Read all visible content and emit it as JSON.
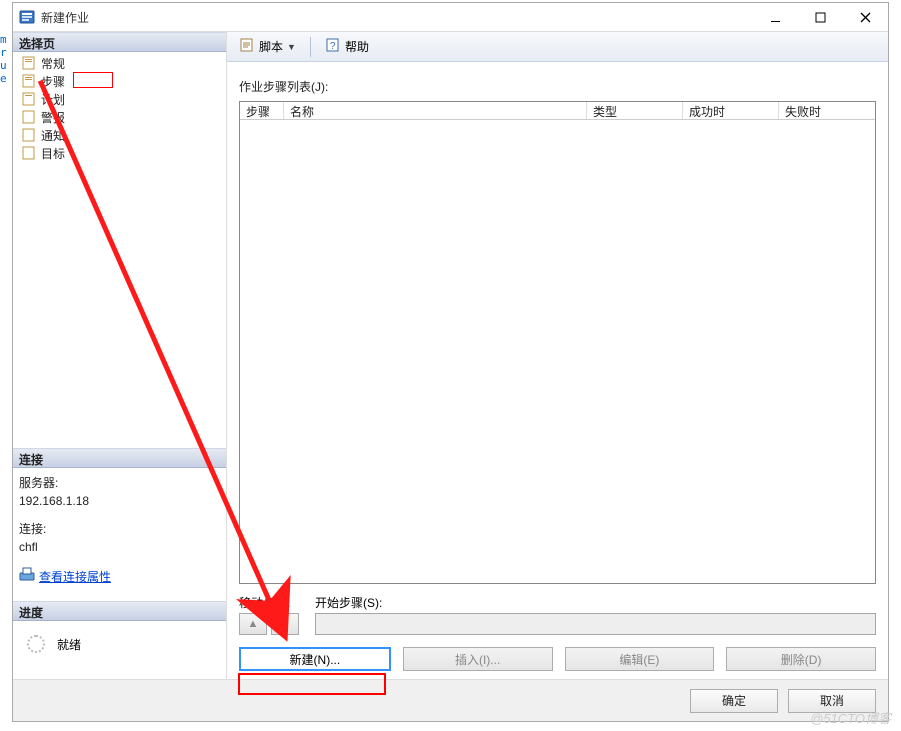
{
  "window": {
    "title": "新建作业"
  },
  "edge": [
    "m",
    "r",
    "u",
    "e"
  ],
  "left": {
    "page_header": "选择页",
    "nav": [
      {
        "label": "常规"
      },
      {
        "label": "步骤"
      },
      {
        "label": "计划"
      },
      {
        "label": "警报"
      },
      {
        "label": "通知"
      },
      {
        "label": "目标"
      }
    ],
    "conn_header": "连接",
    "server_label": "服务器:",
    "server_value": "192.168.1.18",
    "conn_label": "连接:",
    "conn_value": "chfl",
    "view_conn": "查看连接属性",
    "progress_header": "进度",
    "progress_status": "就绪"
  },
  "toolbar": {
    "script": "脚本",
    "help": "帮助"
  },
  "main": {
    "list_label": "作业步骤列表(J):",
    "cols": {
      "c1": "步骤",
      "c2": "名称",
      "c3": "类型",
      "c4": "成功时",
      "c5": "失败时"
    },
    "move_label": "移动步骤:",
    "start_label": "开始步骤(S):",
    "buttons": {
      "new": "新建(N)...",
      "insert": "插入(I)...",
      "edit": "编辑(E)",
      "delete": "删除(D)"
    }
  },
  "footer": {
    "ok": "确定",
    "cancel": "取消"
  },
  "watermark": "@51CTO博客"
}
